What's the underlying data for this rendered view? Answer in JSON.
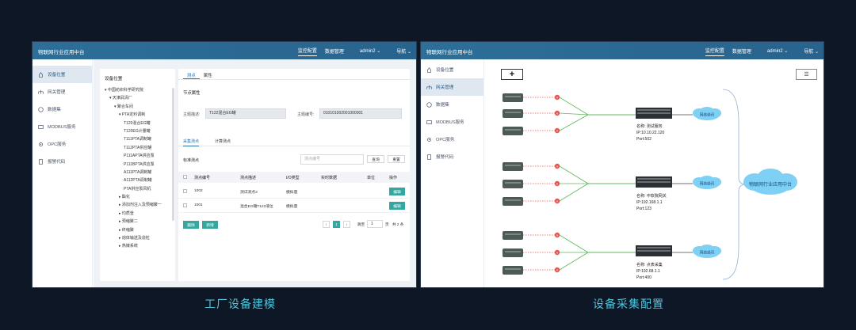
{
  "app_title": "物联网行业应用中台",
  "nav": {
    "items": [
      "监控配置",
      "数据管理",
      "admin2",
      "导航"
    ]
  },
  "sidebar": {
    "items": [
      {
        "label": "设备位置",
        "icon": "location-icon"
      },
      {
        "label": "网关管理",
        "icon": "gateway-icon"
      },
      {
        "label": "数据集",
        "icon": "dataset-icon"
      },
      {
        "label": "MODBUS服务",
        "icon": "server-icon"
      },
      {
        "label": "OPC服务",
        "icon": "gear-icon"
      },
      {
        "label": "报警代码",
        "icon": "document-icon"
      }
    ]
  },
  "left_screen": {
    "tree_header": "设备位置",
    "tree": [
      "中国纺织科学研究院",
      "天津武清厂",
      "聚合车间",
      "PTA定料调制",
      "T120混合EG罐",
      "T120EG计量罐",
      "T111PTA调制罐",
      "T112PTA供应罐",
      "P111APTA供应泵",
      "P111BPTA供应泵",
      "A111PTA调制罐",
      "A112PTA调制罐",
      "PTA供应泵风机",
      "酯化",
      "添加剂注入及预缩聚一",
      "均质釜",
      "预缩聚二",
      "终缩聚",
      "熔体输送及造粒",
      "热媒系统"
    ],
    "tabs": [
      "测点",
      "属性"
    ],
    "node_props_title": "节点属性",
    "topic_desc_label": "主题描述:",
    "topic_desc_value": "T122混合EG罐",
    "topic_id_label": "主题编号:",
    "topic_id_value": "010101002001000001",
    "sub_tabs": [
      "采集测点",
      "计算测点"
    ],
    "table_title": "标准测点",
    "search_placeholder": "测点编号",
    "search_button": "查询",
    "reset_button": "重置",
    "columns": [
      "测点编号",
      "测点描述",
      "I/O类型",
      "实时数据",
      "单位",
      "操作"
    ],
    "rows": [
      {
        "id": "1002",
        "desc": "测试测点2",
        "io": "模拟量",
        "action": "编辑"
      },
      {
        "id": "1001",
        "desc": "混合EG罐T122液位",
        "io": "模拟量",
        "action": "编辑"
      }
    ],
    "add_button": "新增",
    "delete_button": "删除",
    "pager": {
      "current": "1",
      "goto_label": "跳至",
      "goto_value": "1",
      "page_unit": "页",
      "total": "共 2 条"
    }
  },
  "right_screen": {
    "add_label": "+",
    "servers": [
      {
        "name": "名称: 测试服务",
        "ip": "IP:10.10.22.120",
        "port": "Port:502"
      },
      {
        "name": "名称: 中软院网关",
        "ip": "IP:192.168.1.1",
        "port": "Port:123"
      },
      {
        "name": "名称: 点表采集",
        "ip": "IP:192.68.1.1",
        "port": "Port:400"
      }
    ],
    "cloud_label": "网络通讯",
    "central_cloud": "物联网行业应用中台"
  },
  "captions": {
    "left": "工厂设备建模",
    "right": "设备采集配置"
  },
  "colors": {
    "topbar": "#2d6f99",
    "teal": "#34a8a0",
    "caption": "#4fc3d9",
    "cloud": "#7ed0f5",
    "red_marker": "#e8554e",
    "green_link": "#5cb85c"
  }
}
